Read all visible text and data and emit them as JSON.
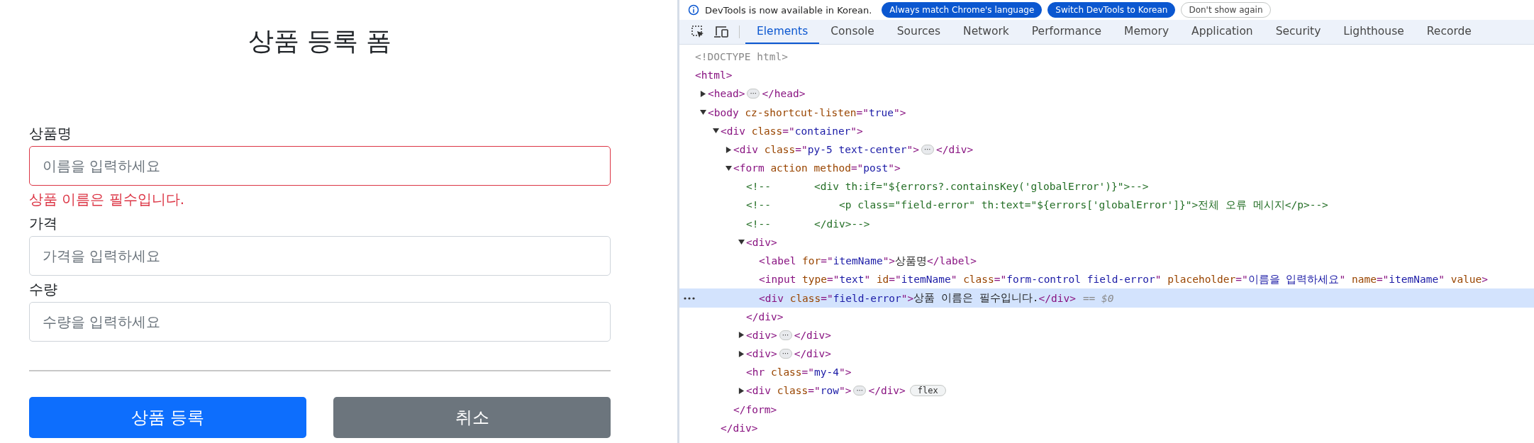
{
  "form": {
    "title": "상품 등록 폼",
    "fields": [
      {
        "label": "상품명",
        "placeholder": "이름을 입력하세요",
        "invalid": true,
        "error": "상품 이름은 필수입니다."
      },
      {
        "label": "가격",
        "placeholder": "가격을 입력하세요",
        "invalid": false
      },
      {
        "label": "수량",
        "placeholder": "수량을 입력하세요",
        "invalid": false
      }
    ],
    "buttons": [
      {
        "label": "상품 등록",
        "kind": "primary"
      },
      {
        "label": "취소",
        "kind": "secondary"
      }
    ]
  },
  "devtools": {
    "banner": {
      "message": "DevTools is now available in Korean.",
      "buttons": [
        {
          "label": "Always match Chrome's language",
          "kind": "filled"
        },
        {
          "label": "Switch DevTools to Korean",
          "kind": "filled"
        },
        {
          "label": "Don't show again",
          "kind": "outline"
        }
      ]
    },
    "tabs": [
      {
        "label": "Elements",
        "selected": true
      },
      {
        "label": "Console",
        "selected": false
      },
      {
        "label": "Sources",
        "selected": false
      },
      {
        "label": "Network",
        "selected": false
      },
      {
        "label": "Performance",
        "selected": false
      },
      {
        "label": "Memory",
        "selected": false
      },
      {
        "label": "Application",
        "selected": false
      },
      {
        "label": "Security",
        "selected": false
      },
      {
        "label": "Lighthouse",
        "selected": false
      },
      {
        "label": "Recorde",
        "selected": false
      }
    ],
    "tree": [
      {
        "selected": false,
        "parts": [
          {
            "kind": "doctype",
            "text": "<!DOCTYPE html>"
          }
        ]
      },
      {
        "selected": false,
        "parts": [
          {
            "kind": "tag",
            "text": "<html>"
          }
        ],
        "children": [
          {
            "selected": false,
            "expanded": false,
            "parts": [
              {
                "kind": "tag",
                "text": "<head>"
              },
              {
                "kind": "more",
                "text": "⋯"
              },
              {
                "kind": "tag",
                "text": "</head>"
              }
            ]
          },
          {
            "selected": false,
            "expanded": true,
            "parts": [
              {
                "kind": "tag",
                "text": "<body "
              },
              {
                "kind": "attr",
                "text": "cz-shortcut-listen"
              },
              {
                "kind": "tag",
                "text": "=\""
              },
              {
                "kind": "value",
                "text": "true"
              },
              {
                "kind": "tag",
                "text": "\">"
              }
            ],
            "children": [
              {
                "selected": false,
                "expanded": true,
                "parts": [
                  {
                    "kind": "tag",
                    "text": "<div "
                  },
                  {
                    "kind": "attr",
                    "text": "class"
                  },
                  {
                    "kind": "tag",
                    "text": "=\""
                  },
                  {
                    "kind": "value",
                    "text": "container"
                  },
                  {
                    "kind": "tag",
                    "text": "\">"
                  }
                ],
                "close": [
                  {
                    "kind": "tag",
                    "text": "</div>"
                  }
                ],
                "children": [
                  {
                    "selected": false,
                    "expanded": false,
                    "parts": [
                      {
                        "kind": "tag",
                        "text": "<div "
                      },
                      {
                        "kind": "attr",
                        "text": "class"
                      },
                      {
                        "kind": "tag",
                        "text": "=\""
                      },
                      {
                        "kind": "value",
                        "text": "py-5 text-center"
                      },
                      {
                        "kind": "tag",
                        "text": "\">"
                      },
                      {
                        "kind": "more",
                        "text": "⋯"
                      },
                      {
                        "kind": "tag",
                        "text": "</div>"
                      }
                    ]
                  },
                  {
                    "selected": false,
                    "expanded": true,
                    "parts": [
                      {
                        "kind": "tag",
                        "text": "<form "
                      },
                      {
                        "kind": "attr",
                        "text": "action method"
                      },
                      {
                        "kind": "tag",
                        "text": "=\""
                      },
                      {
                        "kind": "value",
                        "text": "post"
                      },
                      {
                        "kind": "tag",
                        "text": "\">"
                      }
                    ],
                    "close": [
                      {
                        "kind": "tag",
                        "text": "</form>"
                      }
                    ],
                    "children": [
                      {
                        "selected": false,
                        "parts": [
                          {
                            "kind": "comment",
                            "text": "<!--       <div th:if=\"${errors?.containsKey('globalError')}\">-->"
                          }
                        ]
                      },
                      {
                        "selected": false,
                        "parts": [
                          {
                            "kind": "comment",
                            "text": "<!--           <p class=\"field-error\" th:text=\"${errors['globalError']}\">전체 오류 메시지</p>-->"
                          }
                        ]
                      },
                      {
                        "selected": false,
                        "parts": [
                          {
                            "kind": "comment",
                            "text": "<!--       </div>-->"
                          }
                        ]
                      },
                      {
                        "selected": false,
                        "expanded": true,
                        "parts": [
                          {
                            "kind": "tag",
                            "text": "<div>"
                          }
                        ],
                        "close": [
                          {
                            "kind": "tag",
                            "text": "</div>"
                          }
                        ],
                        "children": [
                          {
                            "selected": false,
                            "parts": [
                              {
                                "kind": "tag",
                                "text": "<label "
                              },
                              {
                                "kind": "attr",
                                "text": "for"
                              },
                              {
                                "kind": "tag",
                                "text": "=\""
                              },
                              {
                                "kind": "value",
                                "text": "itemName"
                              },
                              {
                                "kind": "tag",
                                "text": "\">"
                              },
                              {
                                "kind": "text",
                                "text": "상품명"
                              },
                              {
                                "kind": "tag",
                                "text": "</label>"
                              }
                            ]
                          },
                          {
                            "selected": false,
                            "parts": [
                              {
                                "kind": "tag",
                                "text": "<input "
                              },
                              {
                                "kind": "attr",
                                "text": "type"
                              },
                              {
                                "kind": "tag",
                                "text": "=\""
                              },
                              {
                                "kind": "value",
                                "text": "text"
                              },
                              {
                                "kind": "tag",
                                "text": "\" "
                              },
                              {
                                "kind": "attr",
                                "text": "id"
                              },
                              {
                                "kind": "tag",
                                "text": "=\""
                              },
                              {
                                "kind": "value",
                                "text": "itemName"
                              },
                              {
                                "kind": "tag",
                                "text": "\" "
                              },
                              {
                                "kind": "attr",
                                "text": "class"
                              },
                              {
                                "kind": "tag",
                                "text": "=\""
                              },
                              {
                                "kind": "value",
                                "text": "form-control field-error"
                              },
                              {
                                "kind": "tag",
                                "text": "\" "
                              },
                              {
                                "kind": "attr",
                                "text": "placeholder"
                              },
                              {
                                "kind": "tag",
                                "text": "=\""
                              },
                              {
                                "kind": "value",
                                "text": "이름을 입력하세요"
                              },
                              {
                                "kind": "tag",
                                "text": "\" "
                              },
                              {
                                "kind": "attr",
                                "text": "name"
                              },
                              {
                                "kind": "tag",
                                "text": "=\""
                              },
                              {
                                "kind": "value",
                                "text": "itemName"
                              },
                              {
                                "kind": "tag",
                                "text": "\" "
                              },
                              {
                                "kind": "attr",
                                "text": "value"
                              },
                              {
                                "kind": "tag",
                                "text": ">"
                              }
                            ]
                          },
                          {
                            "selected": true,
                            "parts": [
                              {
                                "kind": "tag",
                                "text": "<div "
                              },
                              {
                                "kind": "attr",
                                "text": "class"
                              },
                              {
                                "kind": "tag",
                                "text": "=\""
                              },
                              {
                                "kind": "value",
                                "text": "field-error"
                              },
                              {
                                "kind": "tag",
                                "text": "\">"
                              },
                              {
                                "kind": "text",
                                "text": "상품 이름은 필수입니다."
                              },
                              {
                                "kind": "tag",
                                "text": "</div>"
                              },
                              {
                                "kind": "hint",
                                "text": "== $0"
                              }
                            ]
                          }
                        ]
                      },
                      {
                        "selected": false,
                        "expanded": false,
                        "parts": [
                          {
                            "kind": "tag",
                            "text": "<div>"
                          },
                          {
                            "kind": "more",
                            "text": "⋯"
                          },
                          {
                            "kind": "tag",
                            "text": "</div>"
                          }
                        ]
                      },
                      {
                        "selected": false,
                        "expanded": false,
                        "parts": [
                          {
                            "kind": "tag",
                            "text": "<div>"
                          },
                          {
                            "kind": "more",
                            "text": "⋯"
                          },
                          {
                            "kind": "tag",
                            "text": "</div>"
                          }
                        ]
                      },
                      {
                        "selected": false,
                        "parts": [
                          {
                            "kind": "tag",
                            "text": "<hr "
                          },
                          {
                            "kind": "attr",
                            "text": "class"
                          },
                          {
                            "kind": "tag",
                            "text": "=\""
                          },
                          {
                            "kind": "value",
                            "text": "my-4"
                          },
                          {
                            "kind": "tag",
                            "text": "\">"
                          }
                        ]
                      },
                      {
                        "selected": false,
                        "expanded": false,
                        "parts": [
                          {
                            "kind": "tag",
                            "text": "<div "
                          },
                          {
                            "kind": "attr",
                            "text": "class"
                          },
                          {
                            "kind": "tag",
                            "text": "=\""
                          },
                          {
                            "kind": "value",
                            "text": "row"
                          },
                          {
                            "kind": "tag",
                            "text": "\">"
                          },
                          {
                            "kind": "more",
                            "text": "⋯"
                          },
                          {
                            "kind": "tag",
                            "text": "</div>"
                          },
                          {
                            "kind": "badge",
                            "text": "flex"
                          }
                        ]
                      }
                    ]
                  }
                ]
              }
            ]
          }
        ]
      }
    ]
  }
}
